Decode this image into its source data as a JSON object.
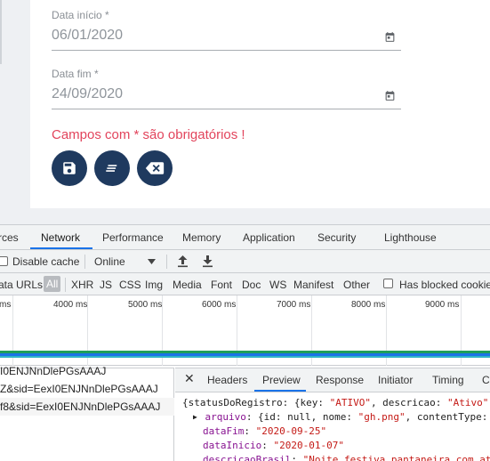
{
  "form": {
    "start_label": "Data início *",
    "start_value": "06/01/2020",
    "end_label": "Data fim *",
    "end_value": "24/09/2020",
    "required_note": "Campos com * são obrigatórios !",
    "buttons": [
      {
        "name": "save-button",
        "icon": "floppy-disk-icon"
      },
      {
        "name": "clear-filter-button",
        "icon": "lines-icon"
      },
      {
        "name": "delete-button",
        "icon": "backspace-x-icon"
      }
    ],
    "accent_color": "#1f3a5f",
    "warning_color": "#e2445c"
  },
  "devtools": {
    "tabs": [
      "rces",
      "Network",
      "Performance",
      "Memory",
      "Application",
      "Security",
      "Lighthouse"
    ],
    "active_tab": "Network",
    "toolbar": {
      "disable_cache": "Disable cache",
      "throttle": "Online"
    },
    "filter": {
      "hide_data_urls": "ata URLs",
      "types": [
        "All",
        "XHR",
        "JS",
        "CSS",
        "Img",
        "Media",
        "Font",
        "Doc",
        "WS",
        "Manifest",
        "Other"
      ],
      "active_type": "All",
      "blocked_cookies": "Has blocked cookie"
    },
    "timeline": {
      "ticks": [
        "ms",
        "4000 ms",
        "5000 ms",
        "6000 ms",
        "7000 ms",
        "8000 ms",
        "9000 ms"
      ]
    },
    "requests": [
      "I0ENJNnDlePGsAAAJ",
      "Z&sid=EexI0ENJNnDlePGsAAAJ",
      "f8&sid=EexI0ENJNnDlePGsAAAJ"
    ],
    "detail": {
      "tabs": [
        "Headers",
        "Preview",
        "Response",
        "Initiator",
        "Timing",
        "C"
      ],
      "active_tab": "Preview",
      "preview": {
        "line1_key": "{statusDoRegistro: {key: ",
        "line1_val": "\"ATIVO\"",
        "line1_rest": ", descricao: ",
        "line1_val2": "\"Ativo\"",
        "line2_key": "arquivo",
        "line2_rest": ": {id: null, nome: ",
        "line2_val": "\"gh.png\"",
        "line2_rest2": ", contentType: ",
        "line3_key": "dataFim",
        "line3_val": "\"2020-09-25\"",
        "line4_key": "dataInicio",
        "line4_val": "\"2020-01-07\"",
        "line5_key": "descricaoBrasil",
        "line5_val": "\"Noite festiva pantaneira com at"
      }
    }
  }
}
